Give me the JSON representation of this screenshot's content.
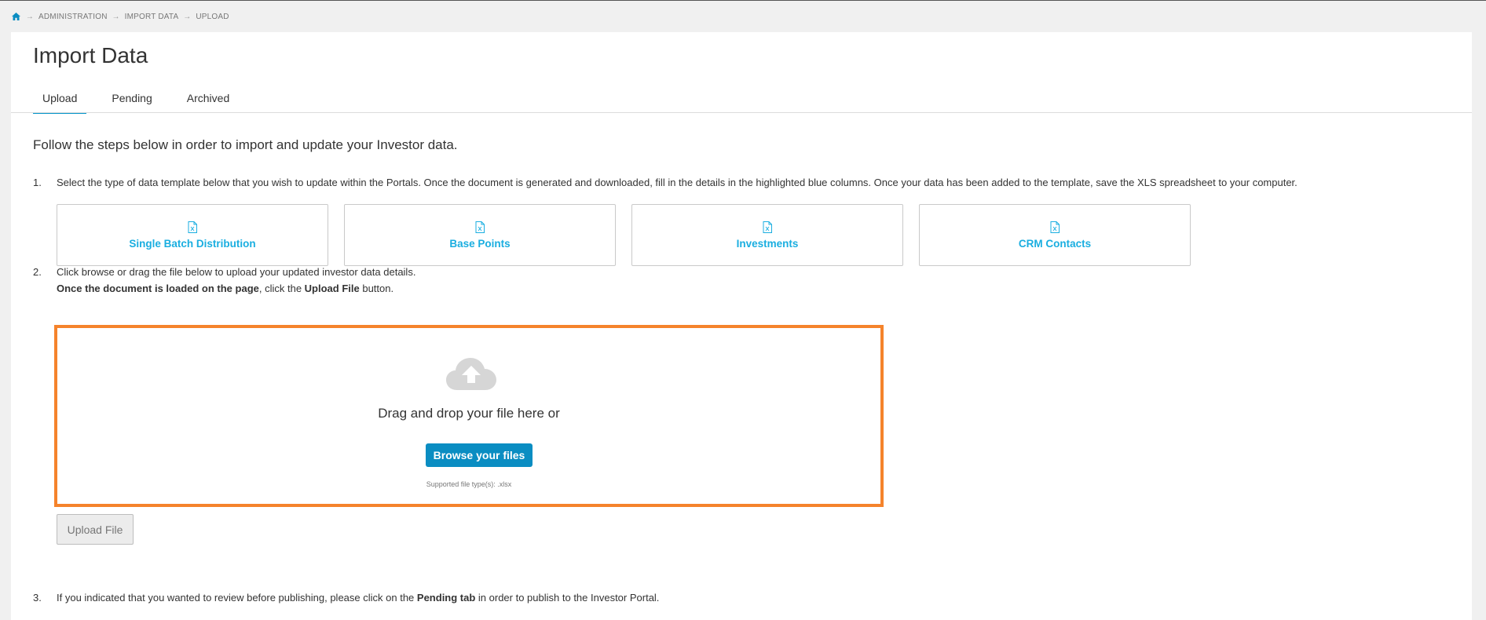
{
  "breadcrumb": {
    "home_icon": "home-icon",
    "items": [
      "ADMINISTRATION",
      "IMPORT DATA",
      "UPLOAD"
    ]
  },
  "page": {
    "title": "Import Data",
    "tabs": [
      {
        "label": "Upload",
        "active": true
      },
      {
        "label": "Pending",
        "active": false
      },
      {
        "label": "Archived",
        "active": false
      }
    ],
    "intro": "Follow the steps below in order to import and update your Investor data."
  },
  "steps": {
    "step1": {
      "num": "1.",
      "text": "Select the type of data template below that you wish to update within the Portals. Once the document is generated and downloaded, fill in the details in the highlighted blue columns. Once your data has been added to the template, save the XLS spreadsheet to your computer."
    },
    "step2": {
      "num": "2.",
      "line1": "Click browse or drag the file below to upload your updated investor data details.",
      "line2_bold1": "Once the document is loaded on the page",
      "line2_mid": ", click the ",
      "line2_bold2": "Upload File",
      "line2_end": " button."
    },
    "step3": {
      "num": "3.",
      "pre": "If you indicated that you wanted to review before publishing, please click on the ",
      "bold": "Pending tab",
      "post": " in order to publish to the Investor Portal."
    }
  },
  "templates": [
    {
      "label": "Single Batch Distribution",
      "icon": "excel-file-icon"
    },
    {
      "label": "Base Points",
      "icon": "excel-file-icon"
    },
    {
      "label": "Investments",
      "icon": "excel-file-icon"
    },
    {
      "label": "CRM Contacts",
      "icon": "excel-file-icon"
    }
  ],
  "dropzone": {
    "icon": "cloud-upload-icon",
    "text": "Drag and drop your file here or",
    "browse_label": "Browse your files",
    "supported": "Supported file type(s): .xlsx"
  },
  "upload_button": "Upload File",
  "colors": {
    "accent": "#0a8dc2",
    "template_link": "#1aaee0",
    "dropzone_border": "#f5832b"
  }
}
